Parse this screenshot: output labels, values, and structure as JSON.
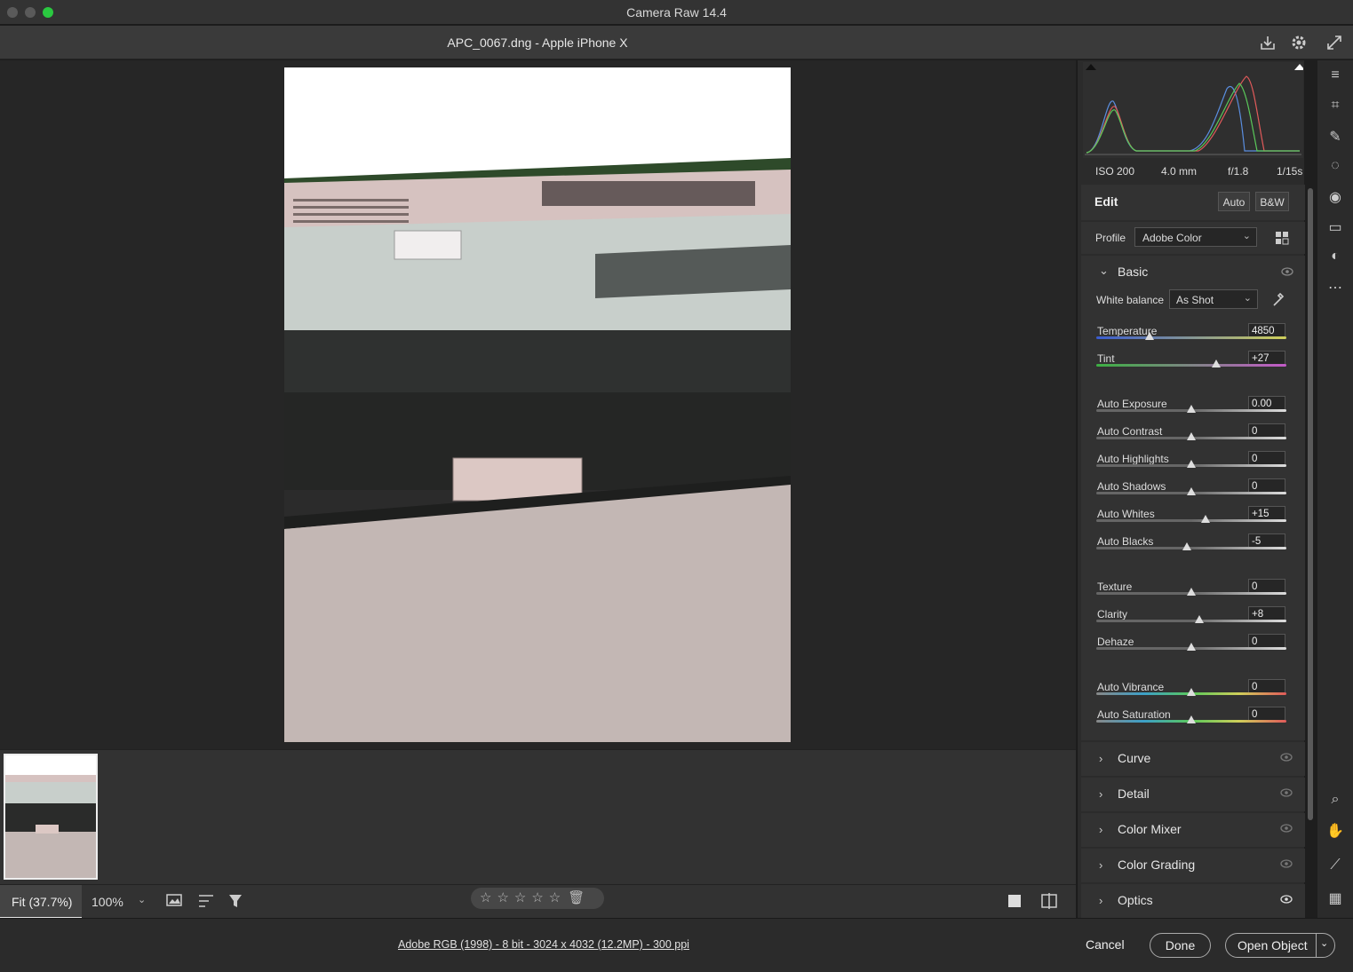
{
  "window": {
    "title": "Camera Raw 14.4",
    "file_title": "APC_0067.dng  -  Apple iPhone X"
  },
  "header_icons": [
    "save-image-icon",
    "settings-gear-icon",
    "fullscreen-icon"
  ],
  "exif": {
    "iso": "ISO 200",
    "focal": "4.0 mm",
    "aperture": "f/1.8",
    "shutter": "1/15s"
  },
  "edit": {
    "title": "Edit",
    "auto_label": "Auto",
    "bw_label": "B&W"
  },
  "profile": {
    "label": "Profile",
    "value": "Adobe Color"
  },
  "basic": {
    "title": "Basic",
    "wb_label": "White balance",
    "wb_value": "As Shot",
    "sliders": [
      {
        "label": "Temperature",
        "value": "4850",
        "level": 0.28,
        "kind": "temp"
      },
      {
        "label": "Tint",
        "value": "+27",
        "level": 0.63,
        "kind": "tint"
      },
      {
        "label": "Auto Exposure",
        "value": "0.00",
        "level": 0.5,
        "kind": "gray"
      },
      {
        "label": "Auto Contrast",
        "value": "0",
        "level": 0.5,
        "kind": "gray"
      },
      {
        "label": "Auto Highlights",
        "value": "0",
        "level": 0.5,
        "kind": "gray"
      },
      {
        "label": "Auto Shadows",
        "value": "0",
        "level": 0.5,
        "kind": "gray"
      },
      {
        "label": "Auto Whites",
        "value": "+15",
        "level": 0.575,
        "kind": "gray"
      },
      {
        "label": "Auto Blacks",
        "value": "-5",
        "level": 0.475,
        "kind": "gray"
      },
      {
        "label": "Texture",
        "value": "0",
        "level": 0.5,
        "kind": "gray"
      },
      {
        "label": "Clarity",
        "value": "+8",
        "level": 0.54,
        "kind": "gray"
      },
      {
        "label": "Dehaze",
        "value": "0",
        "level": 0.5,
        "kind": "gray"
      },
      {
        "label": "Auto Vibrance",
        "value": "0",
        "level": 0.5,
        "kind": "color"
      },
      {
        "label": "Auto Saturation",
        "value": "0",
        "level": 0.5,
        "kind": "color"
      }
    ]
  },
  "sections": [
    "Curve",
    "Detail",
    "Color Mixer",
    "Color Grading",
    "Optics"
  ],
  "bottom": {
    "fit_label": "Fit (37.7%)",
    "zoom_label": "100%",
    "stars": "☆☆☆☆☆"
  },
  "footer": {
    "info": "Adobe RGB (1998) - 8 bit - 3024 x 4032 (12.2MP) - 300 ppi",
    "cancel": "Cancel",
    "done": "Done",
    "open": "Open Object"
  },
  "tools": [
    "edit-sliders-icon",
    "crop-icon",
    "healing-icon",
    "masking-icon",
    "red-eye-icon",
    "snapshots-icon",
    "presets-icon",
    "more-icon",
    "zoom-icon",
    "hand-icon",
    "color-sampler-icon",
    "grid-overlay-icon"
  ],
  "colors": {
    "accent": "#4aa0ff",
    "panel": "#323232",
    "bg": "#1e1e1e"
  }
}
